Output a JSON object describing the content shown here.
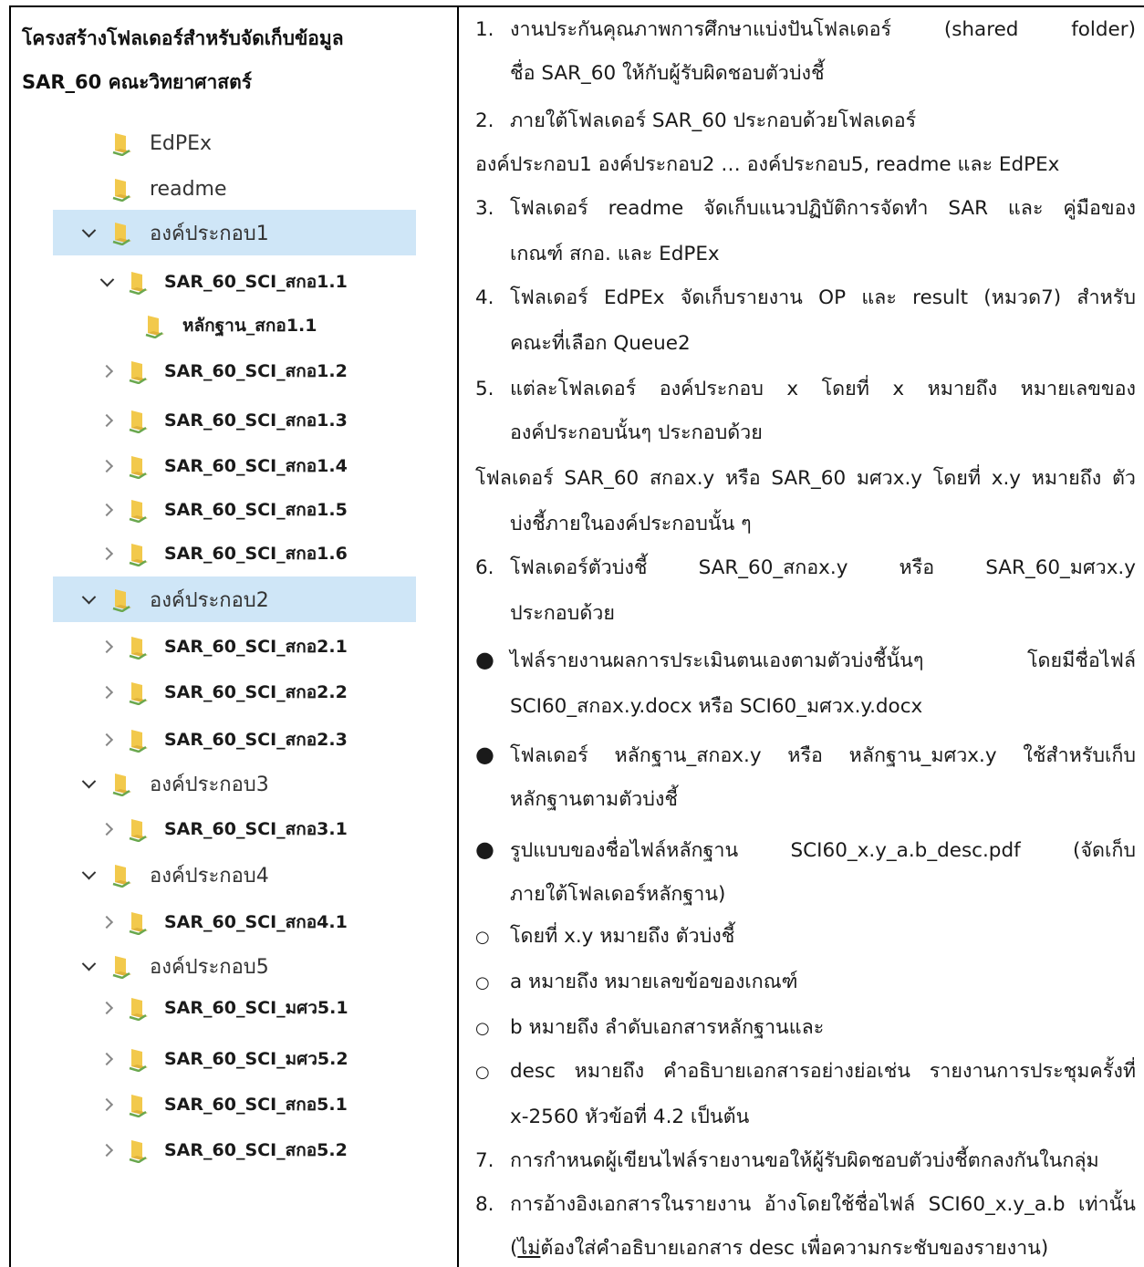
{
  "left": {
    "title_line1": "โครงสร้างโฟลเดอร์สำหรับจัดเก็บข้อมูล",
    "title_line2": "SAR_60 คณะวิทยาศาสตร์",
    "tree": [
      {
        "label": "EdPEx",
        "style": "plain",
        "chevron": "none",
        "selected": false
      },
      {
        "label": "readme",
        "style": "plain",
        "chevron": "none",
        "selected": false
      },
      {
        "label": "องค์ประกอบ1",
        "style": "plain",
        "chevron": "open",
        "selected": true
      },
      {
        "label": "SAR_60_SCI_สกอ1.1",
        "style": "bold",
        "chevron": "open",
        "selected": false
      },
      {
        "label": "หลักฐาน_สกอ1.1",
        "style": "bold",
        "chevron": "none",
        "selected": false
      },
      {
        "label": "SAR_60_SCI_สกอ1.2",
        "style": "bold",
        "chevron": "closed",
        "selected": false
      },
      {
        "label": "SAR_60_SCI_สกอ1.3",
        "style": "bold",
        "chevron": "closed",
        "selected": false
      },
      {
        "label": "SAR_60_SCI_สกอ1.4",
        "style": "bold",
        "chevron": "closed",
        "selected": false
      },
      {
        "label": "SAR_60_SCI_สกอ1.5",
        "style": "bold",
        "chevron": "closed",
        "selected": false
      },
      {
        "label": "SAR_60_SCI_สกอ1.6",
        "style": "bold",
        "chevron": "closed",
        "selected": false
      },
      {
        "label": "องค์ประกอบ2",
        "style": "plain",
        "chevron": "open",
        "selected": true
      },
      {
        "label": "SAR_60_SCI_สกอ2.1",
        "style": "bold",
        "chevron": "closed",
        "selected": false
      },
      {
        "label": "SAR_60_SCI_สกอ2.2",
        "style": "bold",
        "chevron": "closed",
        "selected": false
      },
      {
        "label": "SAR_60_SCI_สกอ2.3",
        "style": "bold",
        "chevron": "closed",
        "selected": false
      },
      {
        "label": "องค์ประกอบ3",
        "style": "plain",
        "chevron": "open",
        "selected": false
      },
      {
        "label": "SAR_60_SCI_สกอ3.1",
        "style": "bold",
        "chevron": "closed",
        "selected": false
      },
      {
        "label": "องค์ประกอบ4",
        "style": "plain",
        "chevron": "open",
        "selected": false
      },
      {
        "label": "SAR_60_SCI_สกอ4.1",
        "style": "bold",
        "chevron": "closed",
        "selected": false
      },
      {
        "label": "องค์ประกอบ5",
        "style": "plain",
        "chevron": "open",
        "selected": false
      },
      {
        "label": "SAR_60_SCI_มศว5.1",
        "style": "bold",
        "chevron": "closed",
        "selected": false
      },
      {
        "label": "SAR_60_SCI_มศว5.2",
        "style": "bold",
        "chevron": "closed",
        "selected": false
      },
      {
        "label": "SAR_60_SCI_สกอ5.1",
        "style": "bold",
        "chevron": "closed",
        "selected": false
      },
      {
        "label": "SAR_60_SCI_สกอ5.2",
        "style": "bold",
        "chevron": "closed",
        "selected": false
      }
    ]
  },
  "right": {
    "lines": [
      {
        "marker": "1.",
        "kind": "num",
        "text": "งานประกันคุณภาพการศึกษาแบ่งปันโฟลเดอร์ (shared folder)",
        "justify": true
      },
      {
        "marker": "",
        "kind": "ind",
        "text": "ชื่อ SAR_60 ให้กับผู้รับผิดชอบตัวบ่งชี้",
        "justify": false
      },
      {
        "marker": "2.",
        "kind": "num",
        "text": "ภายใต้โฟลเดอร์ SAR_60 ประกอบด้วยโฟลเดอร์",
        "justify": false
      },
      {
        "marker": "",
        "kind": "flush",
        "text": "องค์ประกอบ1 องค์ประกอบ2 … องค์ประกอบ5, readme และ EdPEx",
        "justify": false
      },
      {
        "marker": "3.",
        "kind": "num",
        "text": "โฟลเดอร์ readme จัดเก็บแนวปฏิบัติการจัดทำ SAR และ คู่มือของ",
        "justify": true
      },
      {
        "marker": "",
        "kind": "ind",
        "text": "เกณฑ์ สกอ. และ EdPEx",
        "justify": false
      },
      {
        "marker": "4.",
        "kind": "num",
        "text": "โฟลเดอร์ EdPEx จัดเก็บรายงาน OP และ result (หมวด7) สำหรับ",
        "justify": true
      },
      {
        "marker": "",
        "kind": "ind",
        "text": "คณะที่เลือก Queue2",
        "justify": false
      },
      {
        "marker": "5.",
        "kind": "num",
        "text": "แต่ละโฟลเดอร์ องค์ประกอบ x โดยที่ x หมายถึง หมายเลขของ",
        "justify": true
      },
      {
        "marker": "",
        "kind": "ind",
        "text": "องค์ประกอบนั้นๆ ประกอบด้วย",
        "justify": false
      },
      {
        "marker": "",
        "kind": "flush",
        "text": "โฟลเดอร์ SAR_60 สกอx.y หรือ SAR_60 มศวx.y โดยที่ x.y หมายถึง ตัว",
        "justify": true
      },
      {
        "marker": "",
        "kind": "ind",
        "text": "บ่งชี้ภายในองค์ประกอบนั้น ๆ",
        "justify": false
      },
      {
        "marker": "6.",
        "kind": "num",
        "text": "โฟลเดอร์ตัวบ่งชี้ SAR_60_สกอx.y หรือ SAR_60_มศวx.y",
        "justify": true
      },
      {
        "marker": "",
        "kind": "ind",
        "text": "ประกอบด้วย",
        "justify": false
      },
      {
        "marker": "●",
        "kind": "dot",
        "text": "ไฟล์รายงานผลการประเมินตนเองตามตัวบ่งชี้นั้นๆ โดยมีชื่อไฟล์",
        "justify": true
      },
      {
        "marker": "",
        "kind": "ind",
        "text": "SCI60_สกอx.y.docx หรือ SCI60_มศวx.y.docx",
        "justify": false
      },
      {
        "marker": "●",
        "kind": "dot",
        "text": "โฟลเดอร์ หลักฐาน_สกอx.y หรือ หลักฐาน_มศวx.y ใช้สำหรับเก็บ",
        "justify": true
      },
      {
        "marker": "",
        "kind": "ind",
        "text": "หลักฐานตามตัวบ่งชี้",
        "justify": false
      },
      {
        "marker": "●",
        "kind": "dot",
        "text": "รูปแบบของชื่อไฟล์หลักฐาน SCI60_x.y_a.b_desc.pdf (จัดเก็บ",
        "justify": true
      },
      {
        "marker": "",
        "kind": "ind",
        "text": "ภายใต้โฟลเดอร์หลักฐาน)",
        "justify": false
      },
      {
        "marker": "○",
        "kind": "circle",
        "text": "โดยที่ x.y หมายถึง ตัวบ่งชี้",
        "justify": false
      },
      {
        "marker": "○",
        "kind": "circle",
        "text": "a หมายถึง หมายเลขข้อของเกณฑ์",
        "justify": false
      },
      {
        "marker": "○",
        "kind": "circle",
        "text": "b หมายถึง ลำดับเอกสารหลักฐานและ",
        "justify": false
      },
      {
        "marker": "○",
        "kind": "circle",
        "text": "desc หมายถึง คำอธิบายเอกสารอย่างย่อเช่น รายงานการประชุมครั้งที่",
        "justify": true
      },
      {
        "marker": "",
        "kind": "ind",
        "text": "x-2560 หัวข้อที่ 4.2 เป็นต้น",
        "justify": false
      },
      {
        "marker": "7.",
        "kind": "num",
        "text": "การกำหนดผู้เขียนไฟล์รายงานขอให้ผู้รับผิดชอบตัวบ่งชี้ตกลงกันในกลุ่ม",
        "justify": true
      },
      {
        "marker": "8.",
        "kind": "num",
        "text": "การอ้างอิงเอกสารในรายงาน อ้างโดยใช้ชื่อไฟล์ SCI60_x.y_a.b เท่านั้น",
        "justify": true
      }
    ],
    "last_line": {
      "open": "(",
      "underlined": "ไม่",
      "rest": "ต้องใส่คำอธิบายเอกสาร desc เพื่อความกระชับของรายงาน)"
    }
  },
  "colors": {
    "selected_row": "#cfe6f7",
    "folder_yellow": "#f2c94c",
    "folder_green": "#6aa84f"
  }
}
